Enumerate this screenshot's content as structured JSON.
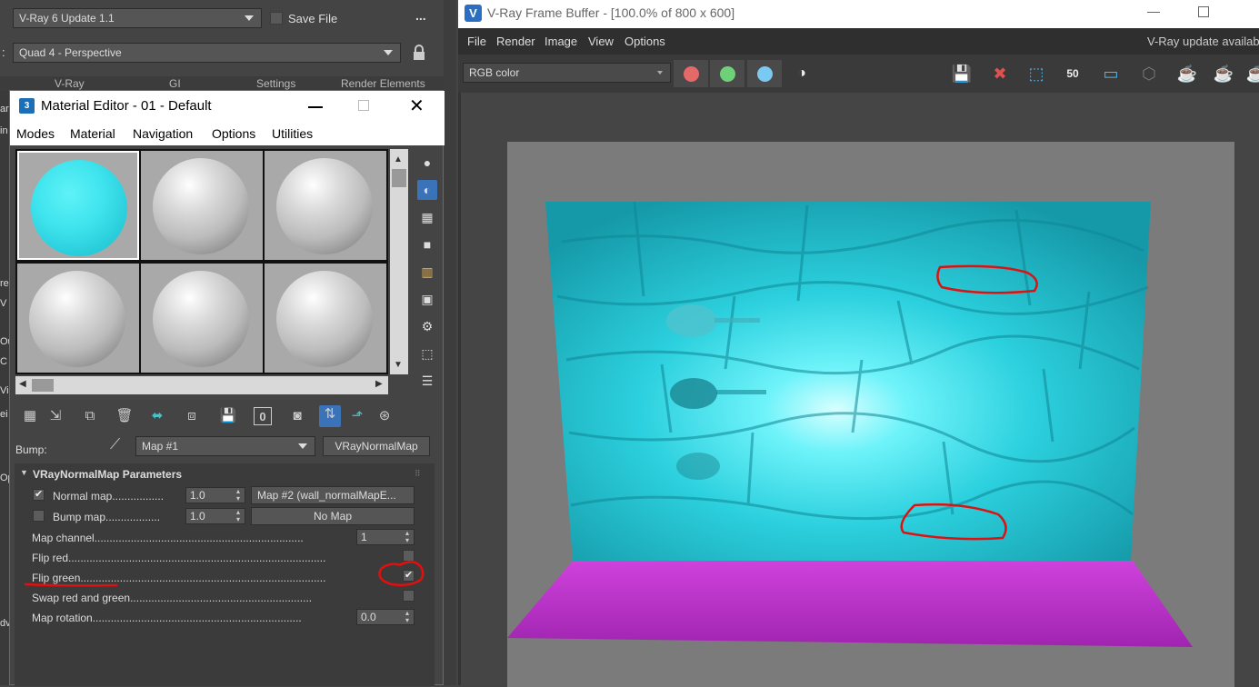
{
  "max": {
    "renderer": "V-Ray 6 Update 1.1",
    "save_file": "Save File",
    "more": "...",
    "view_label": ":",
    "view": "Quad 4 - Perspective",
    "tabs": [
      "V-Ray",
      "GI",
      "Settings",
      "Render Elements"
    ],
    "left_letters": [
      "ar",
      "in",
      "re",
      "V",
      "Ou",
      "C",
      "Vi",
      "ei",
      "Op",
      "dv"
    ]
  },
  "material_editor": {
    "title": "Material Editor - 01 - Default",
    "menu": [
      "Modes",
      "Material",
      "Navigation",
      "Options",
      "Utilities"
    ],
    "bump_label": "Bump:",
    "map_slot": "Map #1",
    "map_type": "VRayNormalMap",
    "rollout_title": "VRayNormalMap Parameters",
    "zero_badge": "0",
    "params": {
      "normal_map_label": "Normal map.................",
      "normal_map_value": "1.0",
      "normal_map_button": "Map #2 (wall_normalMapE...",
      "normal_map_checked": true,
      "bump_map_label": "Bump map..................",
      "bump_map_value": "1.0",
      "bump_map_button": "No Map",
      "bump_map_checked": false,
      "map_channel_label": "Map channel.....................................................................",
      "map_channel_value": "1",
      "flip_red_label": "Flip red.....................................................................................",
      "flip_red_checked": false,
      "flip_green_label": "Flip green.................................................................................",
      "flip_green_checked": true,
      "swap_label": "Swap red and green............................................................",
      "swap_checked": false,
      "rotation_label": "Map rotation.....................................................................",
      "rotation_value": "0.0"
    }
  },
  "frame_buffer": {
    "title": "V-Ray Frame Buffer - [100.0% of 800 x 600]",
    "menu": [
      "File",
      "Render",
      "Image",
      "View",
      "Options"
    ],
    "update_notice": "V-Ray update available",
    "channel": "RGB color",
    "zoom_badge": "50",
    "channel_colors": {
      "red": "#e46a6a",
      "green": "#6fd07a",
      "blue": "#79c9f2"
    }
  },
  "colors": {
    "wall": "#2cd0de",
    "floor": "#b22fbf",
    "annotation": "#e01010",
    "accent_icon": "#4a90e2"
  }
}
